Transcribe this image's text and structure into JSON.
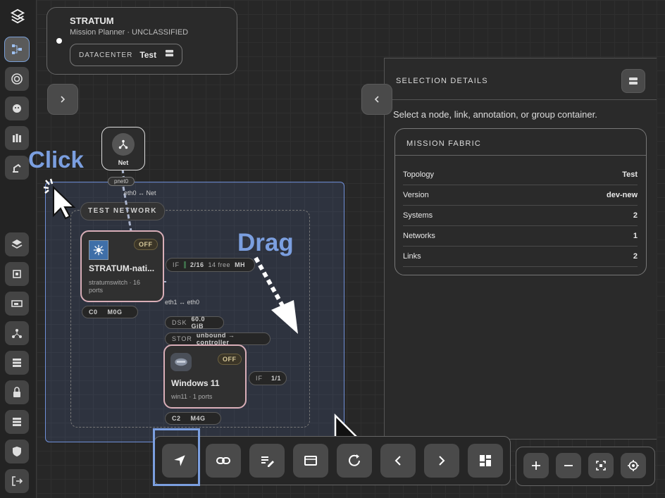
{
  "app": {
    "name": "STRATUM",
    "subtitle": "Mission Planner · UNCLASSIFIED",
    "datacenter_label": "DATACENTER",
    "datacenter_value": "Test"
  },
  "details": {
    "title": "SELECTION DETAILS",
    "hint": "Select a node, link, annotation, or group container.",
    "card_title": "MISSION FABRIC",
    "rows": [
      {
        "k": "Topology",
        "v": "Test"
      },
      {
        "k": "Version",
        "v": "dev-new"
      },
      {
        "k": "Systems",
        "v": "2"
      },
      {
        "k": "Networks",
        "v": "1"
      },
      {
        "k": "Links",
        "v": "2"
      }
    ]
  },
  "diagram": {
    "net_node": {
      "label": "Net",
      "port": "pnet0"
    },
    "link1": "eth0 ↔ Net",
    "link2": "eth1 ↔ eth0",
    "group": "TEST NETWORK",
    "switch": {
      "name": "STRATUM-nati...",
      "desc": "stratumswitch · 16 ports",
      "status": "OFF",
      "cpu": "C0",
      "mem": "M0G",
      "if_key": "IF",
      "if_val": "2/16",
      "if_free": "14 free",
      "if_tag": "MH"
    },
    "vm": {
      "name": "Windows 11",
      "desc": "win11 · 1 ports",
      "status": "OFF",
      "cpu": "C2",
      "mem": "M4G",
      "disk_key": "DSK",
      "disk_val": "60.0 GiB",
      "stor_key": "STOR",
      "stor_val": "unbound → controller",
      "if_key": "IF",
      "if_val": "1/1"
    }
  },
  "annotations": {
    "click": "Click",
    "drag": "Drag"
  },
  "colors": {
    "accent": "#7b9fe0",
    "group": "#6f8fd8",
    "node_border": "#d9aeb8"
  }
}
